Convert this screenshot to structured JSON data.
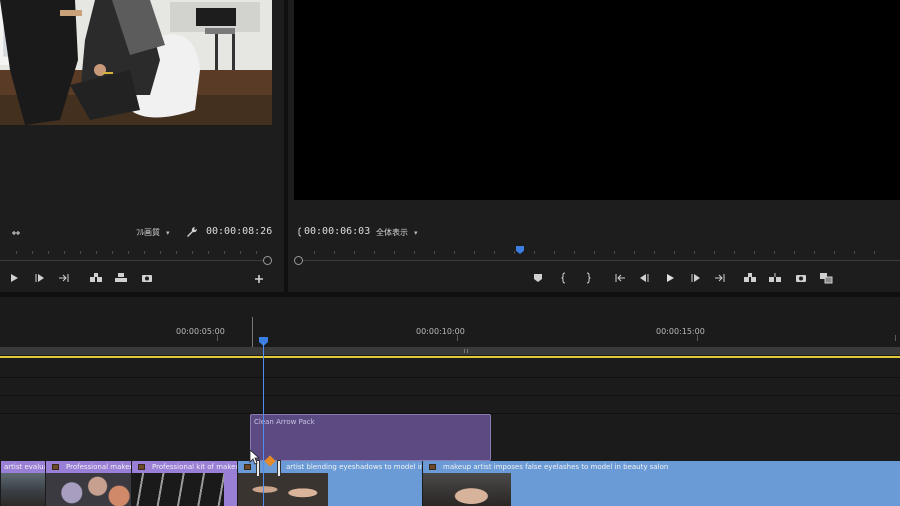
{
  "source_monitor": {
    "timecode": "00:00:08:26",
    "quality": "ﾌﾙ画質",
    "controls": [
      "play",
      "step-forward",
      "go-to-out",
      "insert",
      "overwrite",
      "export-frame",
      "add"
    ]
  },
  "program_monitor": {
    "timecode": "00:00:06:03",
    "fit": "全体表示",
    "controls": [
      "marker",
      "in-point",
      "out-point",
      "go-to-in",
      "step-back",
      "play",
      "step-forward",
      "go-to-out",
      "lift",
      "extract",
      "export-frame",
      "compare"
    ]
  },
  "timeline": {
    "ruler_labels": [
      "00:00:05:00",
      "00:00:10:00",
      "00:00:15:00"
    ],
    "graphic_clip": {
      "label": "Clean Arrow Pack"
    },
    "video_clips": [
      {
        "label": "artist evaluate",
        "color": "#9a7fd6"
      },
      {
        "label": "Professional makeup",
        "color": "#9a7fd6"
      },
      {
        "label": "Professional kit of makeup b",
        "color": "#9a7fd6"
      },
      {
        "label": "artist blending eyeshadows to model in beaut",
        "color": "#6a9bd6"
      },
      {
        "label": "makeup artist imposes false eyelashes to model in beauty salon",
        "color": "#6a9bd6"
      }
    ]
  },
  "colors": {
    "accent_blue": "#3b7de0",
    "work_area_yellow": "#e0c93a",
    "graphic_clip_purple": "#5b4b82"
  }
}
